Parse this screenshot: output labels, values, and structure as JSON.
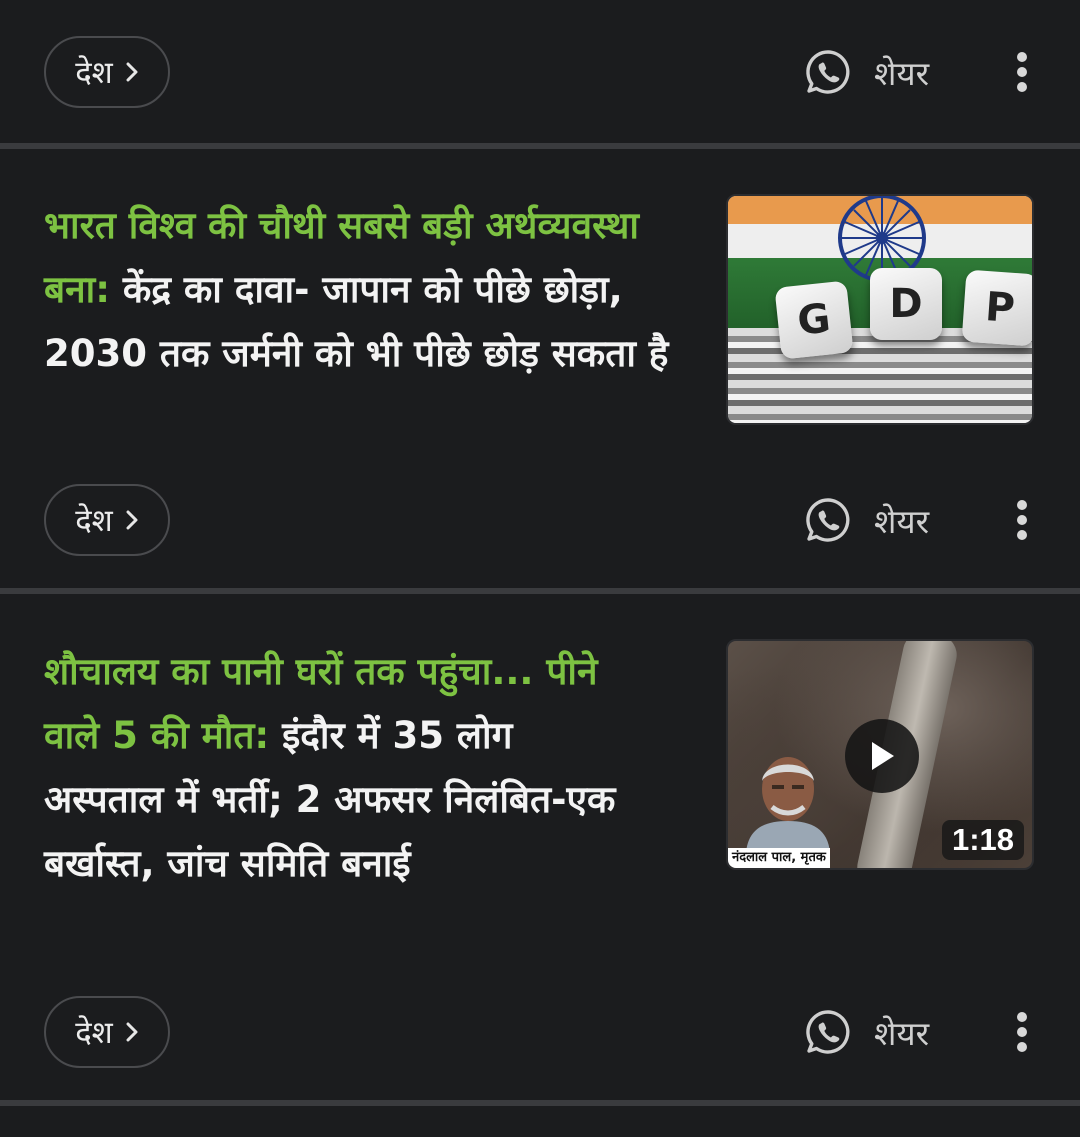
{
  "feed": {
    "top_row": {
      "category": "देश",
      "share_label": "शेयर"
    },
    "articles": [
      {
        "headline_highlight": "भारत विश्व की चौथी सबसे बड़ी अर्थव्यवस्था बना:",
        "headline_rest": " केंद्र का दावा- जापान को पीछे छोड़ा, 2030 तक जर्मनी को भी पीछे छोड़ सकता है",
        "thumbnail": {
          "letters": [
            "G",
            "D",
            "P"
          ],
          "flag_colors": {
            "saffron": "#e89a4d",
            "white": "#eeeeee",
            "green": "#2f7a37",
            "chakra": "#1f3a8a"
          }
        },
        "category": "देश",
        "share_label": "शेयर"
      },
      {
        "headline_highlight": "शौचालय का पानी घरों तक पहुंचा... पीने वाले 5 की मौत:",
        "headline_rest": " इंदौर में 35 लोग अस्पताल में भर्ती; 2 अफसर निलंबित-एक बर्खास्त, जांच समिति बनाई",
        "thumbnail": {
          "caption": "नंदलाल पाल, मृतक",
          "duration": "1:18",
          "icon": "play-icon"
        },
        "category": "देश",
        "share_label": "शेयर"
      }
    ]
  },
  "colors": {
    "background": "#1b1c1e",
    "highlight_green": "#7dc242",
    "divider": "#3a3b3e",
    "text": "#f3f3f3"
  },
  "icons": {
    "share": "whatsapp-icon",
    "more": "more-vertical-icon",
    "chip": "chevron-right-icon"
  }
}
